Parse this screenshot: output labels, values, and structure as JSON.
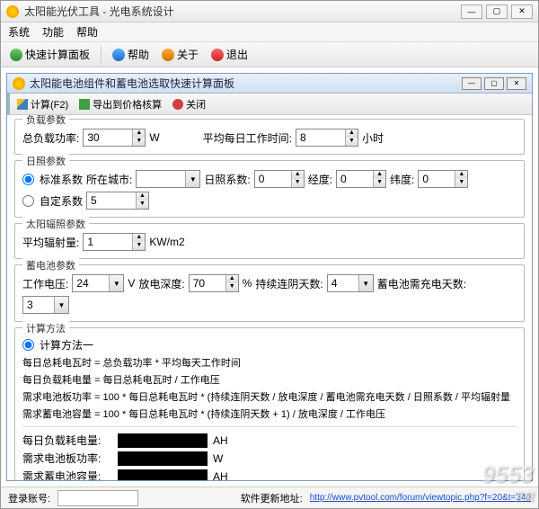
{
  "window": {
    "title": "太阳能光伏工具 - 光电系统设计"
  },
  "menu": {
    "system": "系统",
    "function": "功能",
    "help": "帮助"
  },
  "toolbar": {
    "quick": "快速计算面板",
    "help": "帮助",
    "about": "关于",
    "exit": "退出"
  },
  "panel": {
    "title": "太阳能电池组件和蓄电池选取快速计算面板",
    "calc": "计算(F2)",
    "export": "导出到价格核算",
    "close": "关闭"
  },
  "load": {
    "legend": "负载参数",
    "total_power_label": "总负载功率:",
    "total_power": "30",
    "w": "W",
    "avg_hours_label": "平均每日工作时间:",
    "avg_hours": "8",
    "hours": "小时"
  },
  "sun": {
    "legend": "日照参数",
    "std_label": "标准系数",
    "city_label": "所在城市:",
    "city": "",
    "coef_label": "日照系数:",
    "coef": "0",
    "lon_label": "经度:",
    "lon": "0",
    "lat_label": "纬度:",
    "lat": "0",
    "custom_label": "自定系数",
    "custom": "5"
  },
  "rad": {
    "legend": "太阳辐照参数",
    "avg_label": "平均辐射量:",
    "avg": "1",
    "unit": "KW/m2"
  },
  "bat": {
    "legend": "蓄电池参数",
    "volt_label": "工作电压:",
    "volt": "24",
    "v": "V",
    "depth_label": "放电深度:",
    "depth": "70",
    "pct": "%",
    "rain_label": "持续连阴天数:",
    "rain": "4",
    "charge_label": "蓄电池需充电天数:",
    "charge": "3"
  },
  "method": {
    "legend": "计算方法",
    "m1": "计算方法一",
    "f1": "每日总耗电瓦时 = 总负载功率 * 平均每天工作时间",
    "f2": "每日负载耗电量 = 每日总耗电瓦时 / 工作电压",
    "f3": "需求电池板功率 = 100 * 每日总耗电瓦时 * (持续连阴天数 / 放电深度 / 蓄电池需充电天数 / 日照系数 / 平均辐射量",
    "f4": "需求蓄电池容量 = 100 * 每日总耗电瓦时 * (持续连阴天数 + 1) / 放电深度 / 工作电压",
    "r1_label": "每日负载耗电量:",
    "r1_unit": "AH",
    "r2_label": "需求电池板功率:",
    "r2_unit": "W",
    "r3_label": "需求蓄电池容量:",
    "r3_unit": "AH"
  },
  "status": {
    "login_label": "登录账号:",
    "update_label": "软件更新地址:",
    "url": "http://www.pvtool.com/forum/viewtopic.php?f=20&t=240"
  },
  "watermark": {
    "big": "9553",
    "small": "下载"
  }
}
